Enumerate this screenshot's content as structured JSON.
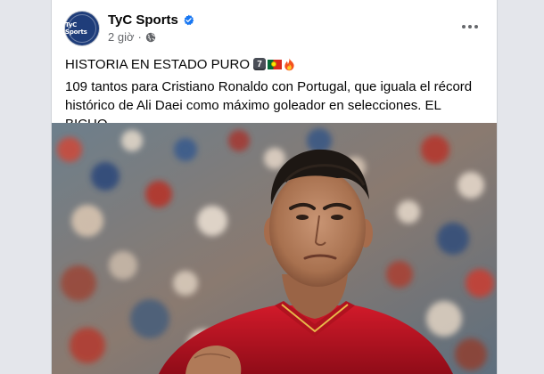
{
  "post": {
    "page_name": "TyC Sports",
    "avatar_text": "TyC Sports",
    "timestamp": "2 giờ",
    "separator": "·",
    "verified_icon": "verified-badge-icon",
    "audience_icon": "globe-icon",
    "menu_icon": "more-options-icon",
    "headline": "HISTORIA EN ESTADO PURO",
    "headline_emojis": [
      "keycap-7",
      "portugal-flag",
      "fire"
    ],
    "keycap_text": "7",
    "body": "109 tantos para Cristiano Ronaldo con Portugal, que iguala el récord histórico de Ali Daei como máximo goleador en selecciones. EL BICHO.",
    "colors": {
      "accent_blue": "#1877f2",
      "text_primary": "#050505",
      "text_secondary": "#65676b",
      "jersey_red": "#c8102e"
    }
  }
}
